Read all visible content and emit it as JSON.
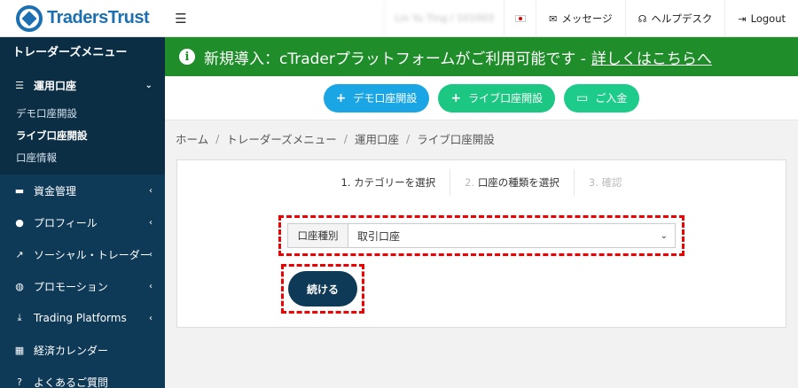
{
  "brand": {
    "name": "TradersTrust"
  },
  "sidebar": {
    "title": "トレーダーズメニュー",
    "items": [
      {
        "label": "運用口座",
        "icon": "list-icon",
        "expanded": true,
        "sub": [
          {
            "label": "デモ口座開設"
          },
          {
            "label": "ライブ口座開設"
          },
          {
            "label": "口座情報"
          }
        ]
      },
      {
        "label": "資金管理",
        "icon": "wallet-icon"
      },
      {
        "label": "プロフィール",
        "icon": "user-icon"
      },
      {
        "label": "ソーシャル・トレーダー",
        "icon": "chart-line-icon"
      },
      {
        "label": "プロモーション",
        "icon": "globe-icon"
      },
      {
        "label": "Trading Platforms",
        "icon": "download-icon"
      },
      {
        "label": "経済カレンダー",
        "icon": "calendar-icon"
      },
      {
        "label": "よくあるご質問",
        "icon": "question-icon"
      }
    ]
  },
  "topbar": {
    "user_id": "Lin Yu Ting / 101003",
    "messages_label": "メッセージ",
    "helpdesk_label": "ヘルプデスク",
    "logout_label": "Logout"
  },
  "banner": {
    "text": "新規導入：cTraderプラットフォームがご利用可能です -",
    "link": "詳しくはこちらへ",
    "color": "#1f8d2a"
  },
  "actions": {
    "demo_label": "デモ口座開設",
    "live_label": "ライブ口座開設",
    "deposit_label": "ご入金"
  },
  "breadcrumb": [
    "ホーム",
    "トレーダーズメニュー",
    "運用口座",
    "ライブ口座開設"
  ],
  "steps": [
    {
      "num": "1.",
      "label": "カテゴリーを選択"
    },
    {
      "num": "2.",
      "label": "口座の種類を選択"
    },
    {
      "num": "3.",
      "label": "確認"
    }
  ],
  "form": {
    "field_label": "口座種別",
    "selected": "取引口座",
    "continue_label": "続ける"
  }
}
